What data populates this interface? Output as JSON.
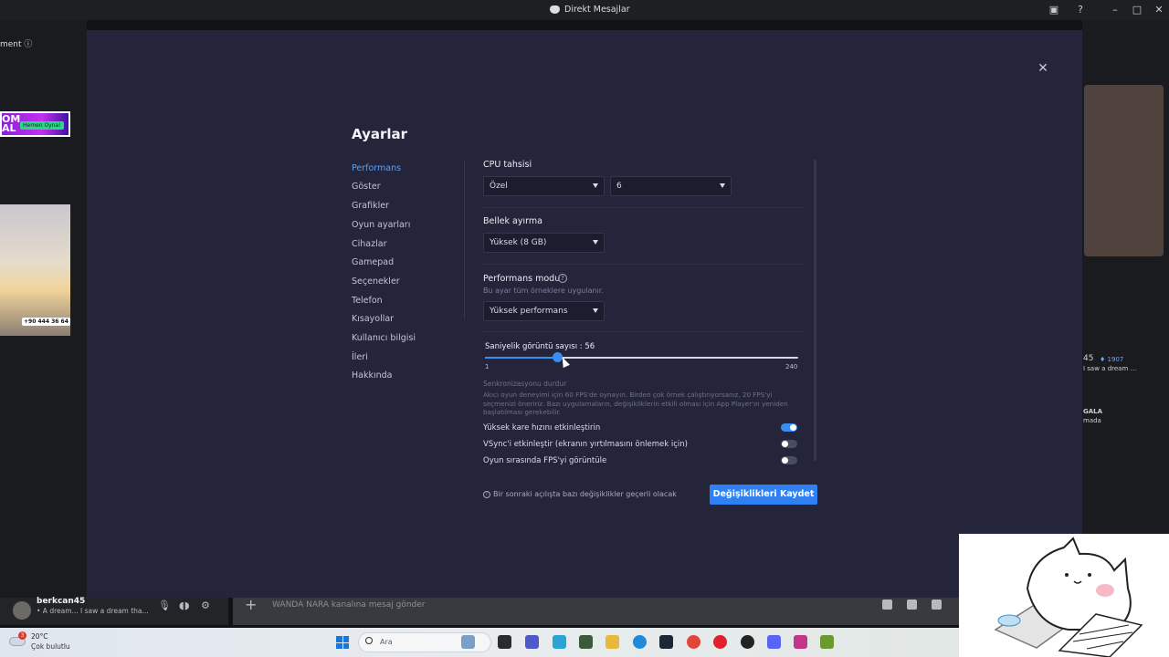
{
  "window": {
    "title": "Direkt Mesajlar"
  },
  "background": {
    "left_text": "ment ⓘ",
    "banner_text": "OM\nAL",
    "banner_button": "Hemen Oyna!",
    "ad_phone": "+90 444 36 64",
    "right_count": "45",
    "right_badge": "♦ 1907",
    "right_msg": "I saw a dream ...",
    "right_name": "GALA",
    "right_sub": "mada"
  },
  "settings": {
    "heading": "Ayarlar",
    "nav": [
      "Performans",
      "Göster",
      "Grafikler",
      "Oyun ayarları",
      "Cihazlar",
      "Gamepad",
      "Seçenekler",
      "Telefon",
      "Kısayollar",
      "Kullanıcı bilgisi",
      "İleri",
      "Hakkında"
    ],
    "active_nav": "Performans",
    "cpu": {
      "label": "CPU tahsisi",
      "mode_value": "Özel",
      "cores_value": "6"
    },
    "memory": {
      "label": "Bellek ayırma",
      "value": "Yüksek (8 GB)"
    },
    "perf_mode": {
      "label": "Performans modu",
      "note": "Bu ayar tüm örneklere uygulanır.",
      "value": "Yüksek performans"
    },
    "fps": {
      "label": "Saniyelik görüntü sayısı : 56",
      "value": 56,
      "min": 1,
      "max": 240,
      "min_label": "1",
      "max_label": "240",
      "desc_title": "Senkronizasyonu durdur",
      "desc_body": "Akıcı oyun deneyimi için 60 FPS'de oynayın. Birden çok örnek çalıştırıyorsanız, 20 FPS'yi seçmenizi öneririz. Bazı uygulamaların, değişikliklerin etkili olması için App Player'ın yeniden başlatılması gerekebilir."
    },
    "toggles": [
      {
        "label": "Yüksek kare hızını etkinleştirin",
        "on": true
      },
      {
        "label": "VSync'i etkinleştir (ekranın yırtılmasını önlemek için)",
        "on": false
      },
      {
        "label": "Oyun sırasında FPS'yi görüntüle",
        "on": false
      }
    ],
    "footer_note": "Bir sonraki açılışta bazı değişiklikler geçerli olacak",
    "save_label": "Değişiklikleri Kaydet"
  },
  "user": {
    "name": "berkcan45",
    "status": "• A dream... I saw a dream tha..."
  },
  "message": {
    "placeholder": "WANDA NARA kanalına mesaj gönder"
  },
  "taskbar": {
    "temperature": "20°C",
    "weather": "Çok bulutlu",
    "weather_badge": "3",
    "search": "Ara"
  },
  "colors": {
    "accent": "#2f80f2",
    "modal_bg": "#24253a"
  }
}
